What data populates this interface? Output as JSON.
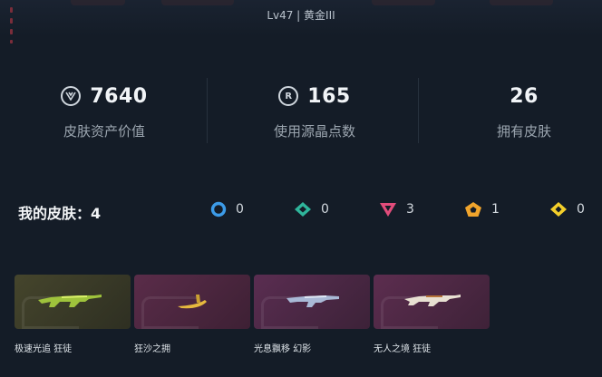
{
  "profile": {
    "level_text": "Lv47 | 黄金III"
  },
  "stats": [
    {
      "icon": "v-points-icon",
      "value": "7640",
      "label": "皮肤资产价值"
    },
    {
      "icon": "radianite-icon",
      "icon_glyph": "R",
      "value": "165",
      "label": "使用源晶点数"
    },
    {
      "icon": "",
      "value": "26",
      "label": "拥有皮肤"
    }
  ],
  "my_skins": {
    "title": "我的皮肤：",
    "count": "4"
  },
  "tiers": [
    {
      "name": "select-tier-icon",
      "color": "#3c9be8",
      "count": "0"
    },
    {
      "name": "deluxe-tier-icon",
      "color": "#2fb59b",
      "count": "0"
    },
    {
      "name": "premium-tier-icon",
      "color": "#e24c7b",
      "count": "3"
    },
    {
      "name": "exclusive-tier-icon",
      "color": "#f0a42c",
      "count": "1"
    },
    {
      "name": "ultra-tier-icon",
      "color": "#f4cf2a",
      "count": "0"
    }
  ],
  "skins": [
    {
      "label": "极速光追 狂徒",
      "bg": "#3a3a26",
      "accent": "#b5d84a"
    },
    {
      "label": "狂沙之拥",
      "bg": "#4b2840",
      "accent": "#e6b93e"
    },
    {
      "label": "光息飘移 幻影",
      "bg": "#4a2a45",
      "accent": "#a9b9d6"
    },
    {
      "label": "无人之境 狂徒",
      "bg": "#4c2a44",
      "accent": "#e8e0d2"
    }
  ]
}
